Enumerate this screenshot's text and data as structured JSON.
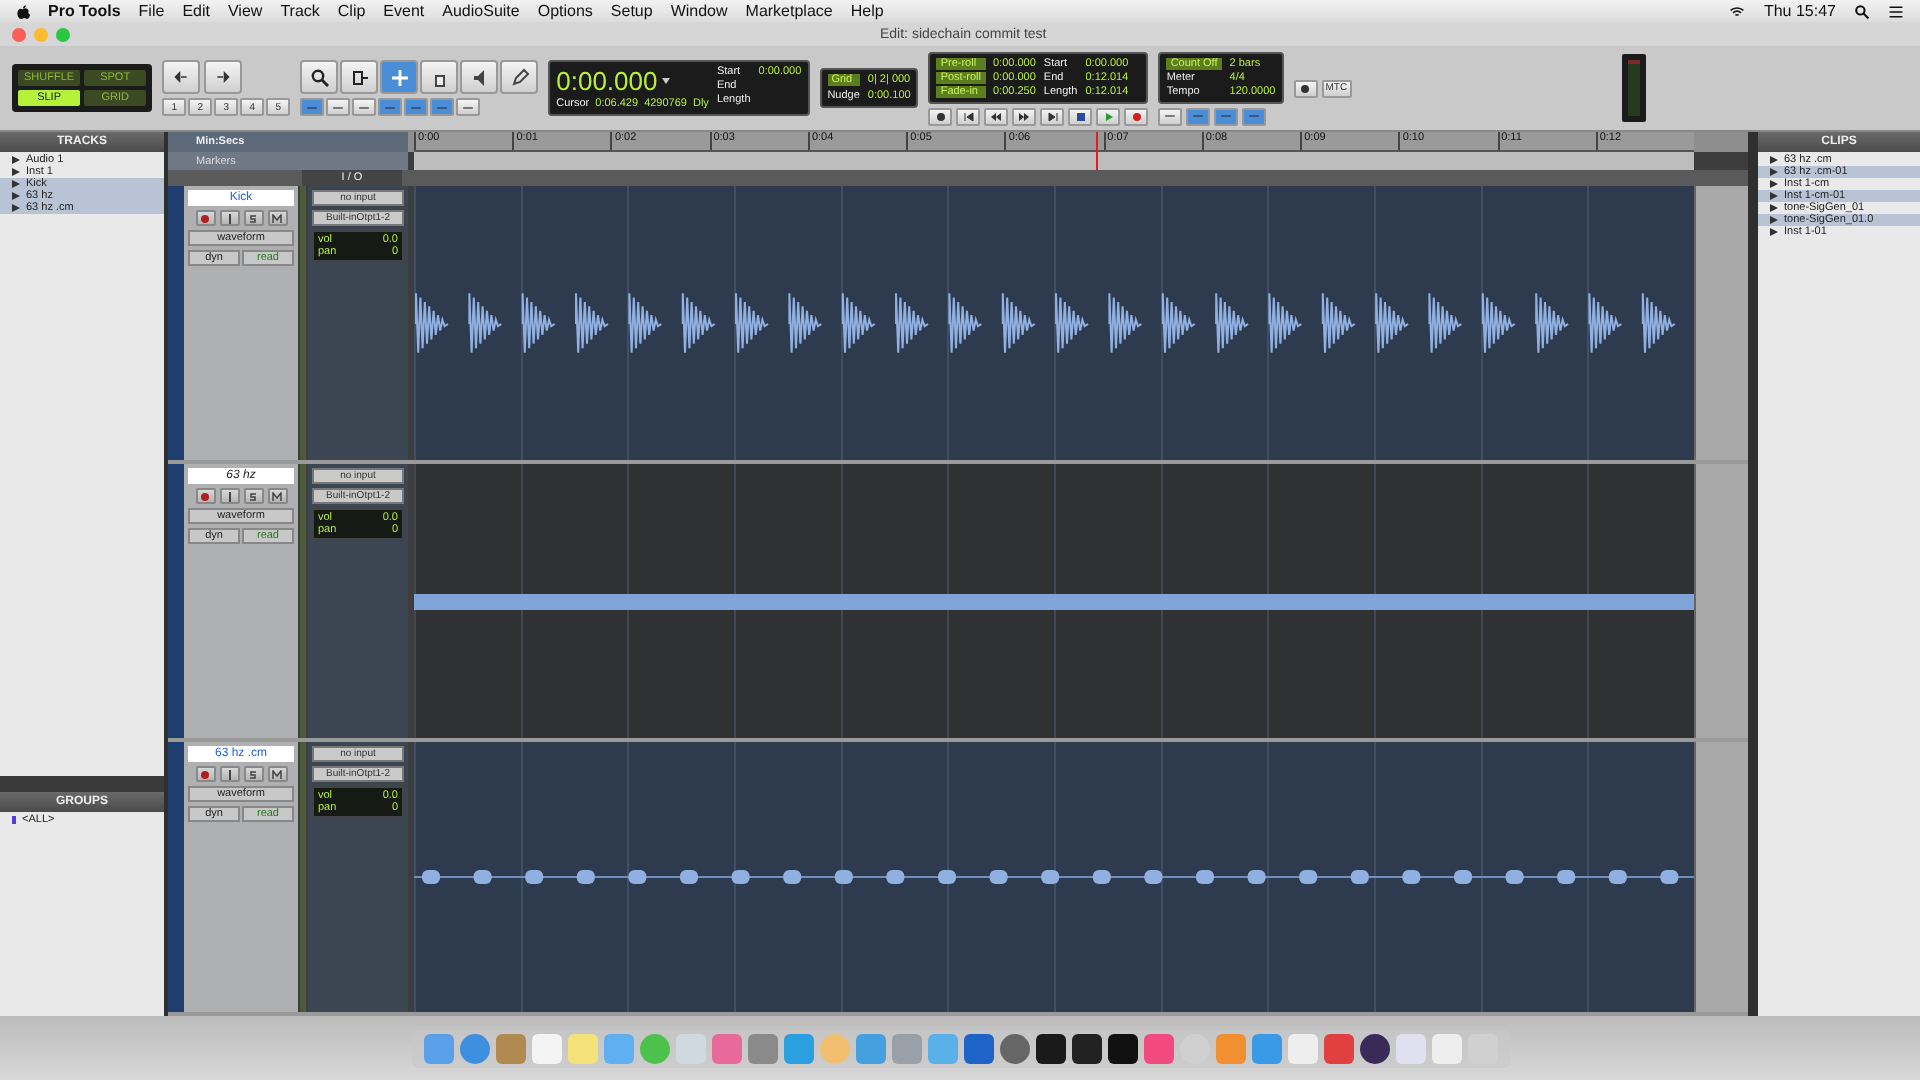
{
  "menu_bar": {
    "app": "Pro Tools",
    "items": [
      "File",
      "Edit",
      "View",
      "Track",
      "Clip",
      "Event",
      "AudioSuite",
      "Options",
      "Setup",
      "Window",
      "Marketplace",
      "Help"
    ],
    "clock": "Thu 15:47"
  },
  "window": {
    "title": "Edit: sidechain commit test"
  },
  "toolbar": {
    "edit_modes": [
      {
        "label": "SHUFFLE",
        "selected": false
      },
      {
        "label": "SPOT",
        "selected": false
      },
      {
        "label": "SLIP",
        "selected": true
      },
      {
        "label": "GRID",
        "selected": false
      }
    ],
    "zoom_presets": [
      "1",
      "2",
      "3",
      "4",
      "5"
    ],
    "counter": {
      "main": "0:00.000",
      "start_label": "Start",
      "start": "0:00.000",
      "end_label": "End",
      "length_label": "Length",
      "cursor_label": "Cursor",
      "cursor": "0:06.429",
      "samples": "4290769",
      "dly": "Dly"
    },
    "grid": {
      "grid_label": "Grid",
      "grid": "0| 2| 000",
      "nudge_label": "Nudge",
      "nudge": "0:00.100"
    },
    "transport": {
      "rows": [
        {
          "label": "Pre-roll",
          "value": "0:00.000",
          "label2": "Start",
          "value2": "0:00.000"
        },
        {
          "label": "Post-roll",
          "value": "0:00.000",
          "label2": "End",
          "value2": "0:12.014"
        },
        {
          "label": "Fade-in",
          "value": "0:00.250",
          "label2": "Length",
          "value2": "0:12.014"
        }
      ]
    },
    "meter": {
      "count_off": "Count Off",
      "bars": "2 bars",
      "meter_label": "Meter",
      "meter": "4/4",
      "tempo_label": "Tempo",
      "tempo": "120.0000"
    },
    "mtc": "MTC"
  },
  "tracks_panel": {
    "title": "TRACKS",
    "items": [
      {
        "name": "Audio 1",
        "selected": false
      },
      {
        "name": "Inst 1",
        "selected": false
      },
      {
        "name": "Kick",
        "selected": true
      },
      {
        "name": "63 hz",
        "selected": true
      },
      {
        "name": "63 hz .cm",
        "selected": true
      }
    ]
  },
  "groups_panel": {
    "title": "GROUPS",
    "items": [
      "<ALL>"
    ]
  },
  "edit": {
    "ruler_label": "Min:Secs",
    "markers_label": "Markers",
    "io_label": "I / O",
    "timeline": [
      "0:00",
      "0:01",
      "0:02",
      "0:03",
      "0:04",
      "0:05",
      "0:06",
      "0:07",
      "0:08",
      "0:09",
      "0:10",
      "0:11",
      "0:12"
    ],
    "tracks": [
      {
        "name": "Kick",
        "selected": true,
        "view": "waveform",
        "dyn": "dyn",
        "automation": "read",
        "input": "no input",
        "output": "Built-inOtpt1-2",
        "vol_label": "vol",
        "vol": "0.0",
        "pan_label": "pan",
        "pan": "0",
        "kind": "kick"
      },
      {
        "name": "63 hz",
        "selected": false,
        "view": "waveform",
        "dyn": "dyn",
        "automation": "read",
        "input": "no input",
        "output": "Built-inOtpt1-2",
        "vol_label": "vol",
        "vol": "0.0",
        "pan_label": "pan",
        "pan": "0",
        "kind": "tone"
      },
      {
        "name": "63 hz .cm",
        "selected": true,
        "view": "waveform",
        "dyn": "dyn",
        "automation": "read",
        "input": "no input",
        "output": "Built-inOtpt1-2",
        "vol_label": "vol",
        "vol": "0.0",
        "pan_label": "pan",
        "pan": "0",
        "kind": "blips"
      }
    ]
  },
  "clips_panel": {
    "title": "CLIPS",
    "items": [
      {
        "name": "63 hz .cm",
        "selected": false
      },
      {
        "name": "63 hz .cm-01",
        "selected": true
      },
      {
        "name": "Inst 1-cm",
        "selected": false
      },
      {
        "name": "Inst 1-cm-01",
        "selected": true
      },
      {
        "name": "tone-SigGen_01",
        "selected": false
      },
      {
        "name": "tone-SigGen_01.0",
        "selected": true
      },
      {
        "name": "Inst 1-01",
        "selected": false
      }
    ]
  }
}
